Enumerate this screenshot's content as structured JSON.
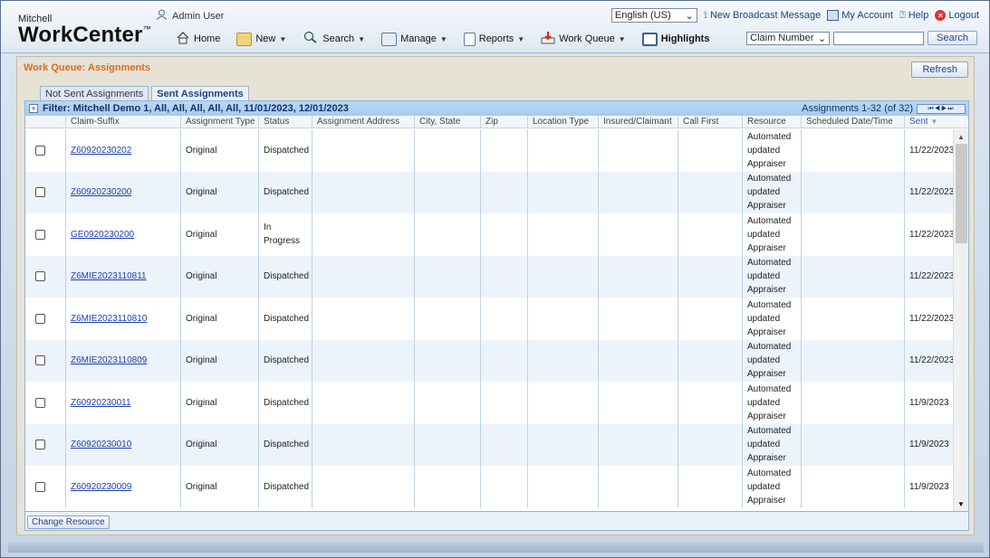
{
  "brand": {
    "small": "Mitchell",
    "big": "WorkCenter",
    "mark": "™"
  },
  "user": {
    "label": "Admin User"
  },
  "top_links": {
    "language": "English (US)",
    "broadcast": "New Broadcast Message",
    "account": "My Account",
    "help": "Help",
    "logout": "Logout"
  },
  "nav": {
    "home": "Home",
    "new": "New",
    "search": "Search",
    "manage": "Manage",
    "reports": "Reports",
    "work_queue": "Work Queue",
    "highlights": "Highlights"
  },
  "search": {
    "field": "Claim Number",
    "value": "",
    "button": "Search"
  },
  "page": {
    "title": "Work Queue: Assignments",
    "refresh": "Refresh"
  },
  "tabs": [
    {
      "label": "Not Sent Assignments",
      "active": false
    },
    {
      "label": "Sent Assignments",
      "active": true
    }
  ],
  "filter": {
    "text": "Filter: Mitchell Demo 1, All, All, All, All, All, 11/01/2023, 12/01/2023",
    "count": "Assignments 1-32 (of 32)"
  },
  "columns": [
    "Claim-Suffix",
    "Assignment Type",
    "Status",
    "Assignment Address",
    "City, State",
    "Zip",
    "Location Type",
    "Insured/Claimant",
    "Call First",
    "Resource",
    "Scheduled Date/Time",
    "Sent"
  ],
  "rows": [
    {
      "claim": "Z60920230202",
      "type": "Original",
      "status": "Dispatched",
      "resource": "Automated updated Appraiser",
      "sent": "11/22/2023"
    },
    {
      "claim": "Z60920230200",
      "type": "Original",
      "status": "Dispatched",
      "resource": "Automated updated Appraiser",
      "sent": "11/22/2023"
    },
    {
      "claim": "GE0920230200",
      "type": "Original",
      "status": "In Progress",
      "resource": "Automated updated Appraiser",
      "sent": "11/22/2023"
    },
    {
      "claim": "Z6MIE2023110811",
      "type": "Original",
      "status": "Dispatched",
      "resource": "Automated updated Appraiser",
      "sent": "11/22/2023"
    },
    {
      "claim": "Z6MIE2023110810",
      "type": "Original",
      "status": "Dispatched",
      "resource": "Automated updated Appraiser",
      "sent": "11/22/2023"
    },
    {
      "claim": "Z6MIE2023110809",
      "type": "Original",
      "status": "Dispatched",
      "resource": "Automated updated Appraiser",
      "sent": "11/22/2023"
    },
    {
      "claim": "Z60920230011",
      "type": "Original",
      "status": "Dispatched",
      "resource": "Automated updated Appraiser",
      "sent": "11/9/2023"
    },
    {
      "claim": "Z60920230010",
      "type": "Original",
      "status": "Dispatched",
      "resource": "Automated updated Appraiser",
      "sent": "11/9/2023"
    },
    {
      "claim": "Z60920230009",
      "type": "Original",
      "status": "Dispatched",
      "resource": "Automated updated Appraiser",
      "sent": "11/9/2023"
    }
  ],
  "footer": {
    "change_resource": "Change Resource"
  },
  "colors": {
    "accent_orange": "#e06b1a",
    "link_blue": "#1a3fb0",
    "header_blue": "#a6cbed"
  }
}
